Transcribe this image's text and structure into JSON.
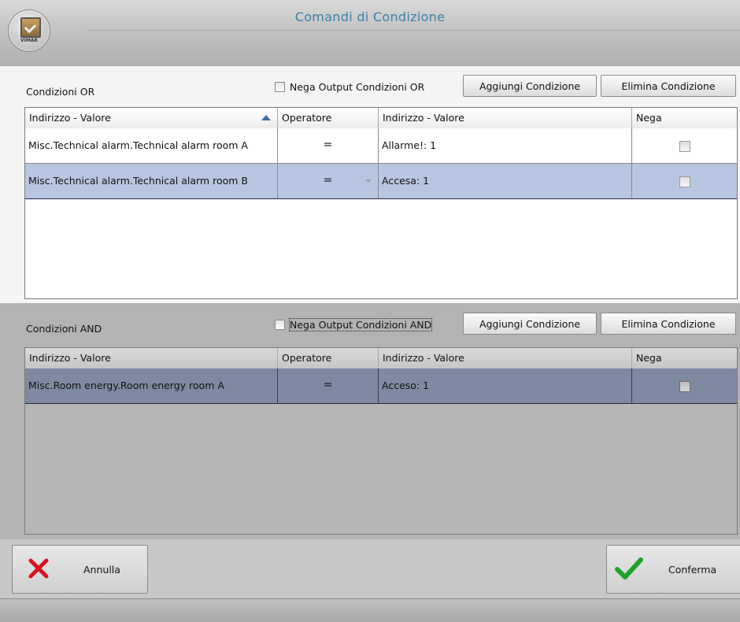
{
  "window": {
    "title": "Comandi di Condizione",
    "logo_text": "VIMAR"
  },
  "or_section": {
    "label": "Condizioni OR",
    "negate_label": "Nega Output Condizioni OR",
    "negate_checked": false,
    "add_button": "Aggiungi Condizione",
    "delete_button": "Elimina Condizione",
    "columns": [
      "Indirizzo - Valore",
      "Operatore",
      "Indirizzo - Valore",
      "Nega"
    ],
    "rows": [
      {
        "address": "Misc.Technical alarm.Technical alarm room A",
        "operator": "=",
        "value": "Allarme!: 1",
        "negate": false,
        "selected": false
      },
      {
        "address": "Misc.Technical alarm.Technical alarm room B",
        "operator": "=",
        "value": "Accesa: 1",
        "negate": false,
        "selected": true
      }
    ]
  },
  "and_section": {
    "label": "Condizioni AND",
    "negate_label": "Nega Output Condizioni AND",
    "negate_checked": false,
    "add_button": "Aggiungi Condizione",
    "delete_button": "Elimina Condizione",
    "columns": [
      "Indirizzo - Valore",
      "Operatore",
      "Indirizzo - Valore",
      "Nega"
    ],
    "rows": [
      {
        "address": "Misc.Room energy.Room energy room A",
        "operator": "=",
        "value": "Acceso: 1",
        "negate": false,
        "selected": true
      }
    ]
  },
  "footer": {
    "cancel_label": "Annulla",
    "confirm_label": "Conferma",
    "cancel_icon": "red-x-icon",
    "confirm_icon": "green-check-icon"
  },
  "colors": {
    "title_text": "#3c7fa7",
    "selected_row_or": "#b8c6e2",
    "selected_row_and": "#7f8aa2",
    "cancel_icon": "#d7141e",
    "confirm_icon": "#1fa02a"
  }
}
